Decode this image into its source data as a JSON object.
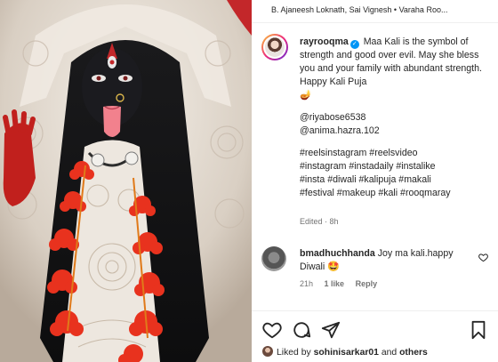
{
  "audio": "B. Ajaneesh Loknath, Sai Vignesh • Varaha Roo...",
  "post": {
    "username": "rayrooqma",
    "verified_mark": "✓",
    "caption": "Maa Kali is the symbol of strength and good over evil. May she bless you and your family with abundant strength. Happy Kali Puja",
    "caption_emoji": "🪔",
    "mentions": [
      "@riyabose6538",
      "@anima.hazra.102"
    ],
    "hashtags_lines": [
      "#reelsinstagram #reelsvideo",
      "#instagram #instadaily #instalike",
      "#insta #diwali #kalipuja #makali",
      "#festival #makeup #kali #rooqmaray"
    ],
    "meta": "Edited · 8h"
  },
  "comment": {
    "username": "bmadhuchhanda",
    "text": "Joy ma kali.happy Diwali",
    "emoji": "🤩",
    "time": "21h",
    "likes": "1 like",
    "reply": "Reply"
  },
  "actions": {
    "like": "heart-icon",
    "comment": "comment-icon",
    "share": "send-icon",
    "save": "bookmark-icon"
  },
  "likes": {
    "prefix": "Liked by",
    "user": "sohinisarkar01",
    "mid": "and",
    "others": "others"
  },
  "colors": {
    "verified": "#0095f6",
    "skin": "#1b1b1f",
    "tongue": "#f2818d",
    "hibiscus": "#e8321e"
  }
}
